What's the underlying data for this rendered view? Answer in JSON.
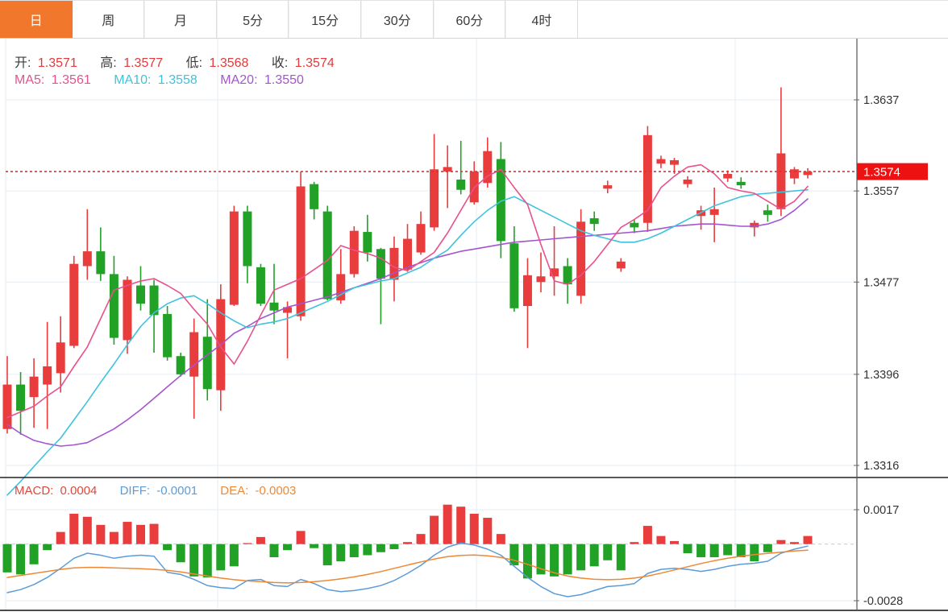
{
  "tabs": {
    "items": [
      {
        "label": "日",
        "active": true
      },
      {
        "label": "周",
        "active": false
      },
      {
        "label": "月",
        "active": false
      },
      {
        "label": "5分",
        "active": false
      },
      {
        "label": "15分",
        "active": false
      },
      {
        "label": "30分",
        "active": false
      },
      {
        "label": "60分",
        "active": false
      },
      {
        "label": "4时",
        "active": false
      }
    ]
  },
  "ohlc_row": {
    "open_label": "开:",
    "open": "1.3571",
    "high_label": "高:",
    "high": "1.3577",
    "low_label": "低:",
    "low": "1.3568",
    "close_label": "收:",
    "close": "1.3574"
  },
  "ma_row": {
    "ma5_label": "MA5:",
    "ma5": "1.3561",
    "ma10_label": "MA10:",
    "ma10": "1.3558",
    "ma20_label": "MA20:",
    "ma20": "1.3550"
  },
  "macd_row": {
    "macd_label": "MACD:",
    "macd": "0.0004",
    "diff_label": "DIFF:",
    "diff": "-0.0001",
    "dea_label": "DEA:",
    "dea": "-0.0003"
  },
  "price_axis": {
    "labels": [
      {
        "text": "1.3637",
        "price": 1.3637
      },
      {
        "text": "1.3557",
        "price": 1.3557
      },
      {
        "text": "1.3477",
        "price": 1.3477
      },
      {
        "text": "1.3396",
        "price": 1.3396
      },
      {
        "text": "1.3316",
        "price": 1.3316
      }
    ],
    "last_price_tag": "1.3574",
    "last_price": 1.3574
  },
  "macd_axis": {
    "labels": [
      {
        "text": "0.0017",
        "value": 0.0017
      },
      {
        "text": "-0.0028",
        "value": -0.0028
      }
    ]
  },
  "colors": {
    "tab_active_bg": "#f0772c",
    "up": "#e93c3c",
    "down": "#21a126",
    "ma5": "#e8508e",
    "ma10": "#3fc3dc",
    "ma20": "#a455ce",
    "diff": "#5b9cd8",
    "dea": "#ee8833",
    "value_red": "#e23b3b",
    "macd_label_red": "#dd4a3c",
    "grid": "#e7edf3",
    "axis_line": "#555555",
    "axis_text": "#333333",
    "price_tag_bg": "#ee1111",
    "price_tag_text": "#ffffff",
    "dashed_price": "#e03030",
    "zero_line": "#a8cfe8",
    "separator": "#222222"
  },
  "chart_data": {
    "type": "candlestick+macd",
    "title": "",
    "price_axis_ticks": [
      1.3637,
      1.3557,
      1.3477,
      1.3396,
      1.3316
    ],
    "macd_axis_ticks": [
      0.0017,
      -0.0028
    ],
    "current_price": 1.3574,
    "candles_ohlc": [
      [
        1.3348,
        1.3412,
        1.3344,
        1.3387
      ],
      [
        1.3387,
        1.3398,
        1.3343,
        1.3364
      ],
      [
        1.3376,
        1.341,
        1.3349,
        1.3394
      ],
      [
        1.3387,
        1.3442,
        1.3348,
        1.3403
      ],
      [
        1.3397,
        1.3447,
        1.338,
        1.3424
      ],
      [
        1.3421,
        1.35,
        1.3419,
        1.3493
      ],
      [
        1.3491,
        1.3541,
        1.3479,
        1.3504
      ],
      [
        1.3504,
        1.3525,
        1.3478,
        1.3484
      ],
      [
        1.3484,
        1.35,
        1.3422,
        1.3428
      ],
      [
        1.3426,
        1.3482,
        1.3414,
        1.3479
      ],
      [
        1.3474,
        1.3491,
        1.3452,
        1.3458
      ],
      [
        1.3474,
        1.3479,
        1.3415,
        1.3448
      ],
      [
        1.3449,
        1.3456,
        1.3408,
        1.3411
      ],
      [
        1.3412,
        1.3415,
        1.3394,
        1.3396
      ],
      [
        1.3394,
        1.3445,
        1.3357,
        1.3433
      ],
      [
        1.3429,
        1.3462,
        1.3373,
        1.3383
      ],
      [
        1.3382,
        1.3475,
        1.3364,
        1.3462
      ],
      [
        1.3457,
        1.3544,
        1.3456,
        1.3539
      ],
      [
        1.3539,
        1.3544,
        1.3476,
        1.3491
      ],
      [
        1.349,
        1.3493,
        1.3456,
        1.3458
      ],
      [
        1.3459,
        1.3493,
        1.344,
        1.3452
      ],
      [
        1.345,
        1.346,
        1.341,
        1.3455
      ],
      [
        1.3447,
        1.3574,
        1.3443,
        1.3561
      ],
      [
        1.3563,
        1.3565,
        1.3532,
        1.3541
      ],
      [
        1.3539,
        1.3544,
        1.3461,
        1.3462
      ],
      [
        1.3461,
        1.3506,
        1.3458,
        1.3484
      ],
      [
        1.3484,
        1.3526,
        1.3481,
        1.3522
      ],
      [
        1.3521,
        1.3536,
        1.3495,
        1.3503
      ],
      [
        1.3506,
        1.3507,
        1.344,
        1.348
      ],
      [
        1.3479,
        1.3517,
        1.346,
        1.3507
      ],
      [
        1.3488,
        1.3528,
        1.3486,
        1.3515
      ],
      [
        1.3503,
        1.3539,
        1.3501,
        1.3528
      ],
      [
        1.3525,
        1.3607,
        1.3522,
        1.3576
      ],
      [
        1.3574,
        1.3597,
        1.3542,
        1.3578
      ],
      [
        1.3567,
        1.3601,
        1.3554,
        1.3558
      ],
      [
        1.3547,
        1.3583,
        1.3545,
        1.3574
      ],
      [
        1.3564,
        1.3604,
        1.356,
        1.3592
      ],
      [
        1.3585,
        1.36,
        1.3498,
        1.3513
      ],
      [
        1.3511,
        1.3526,
        1.3451,
        1.3454
      ],
      [
        1.3456,
        1.3498,
        1.3419,
        1.3483
      ],
      [
        1.3477,
        1.3503,
        1.3468,
        1.3482
      ],
      [
        1.3482,
        1.3526,
        1.3465,
        1.3489
      ],
      [
        1.3491,
        1.3498,
        1.3458,
        1.3475
      ],
      [
        1.3465,
        1.3541,
        1.3458,
        1.353
      ],
      [
        1.3533,
        1.3539,
        1.3522,
        1.3528
      ],
      [
        1.3559,
        1.3566,
        1.3555,
        1.3562
      ],
      [
        1.3489,
        1.3498,
        1.3486,
        1.3495
      ],
      [
        1.3529,
        1.3532,
        1.352,
        1.3525
      ],
      [
        1.3529,
        1.3614,
        1.3521,
        1.3606
      ],
      [
        1.3581,
        1.3588,
        1.3577,
        1.3585
      ],
      [
        1.358,
        1.3586,
        1.3572,
        1.3584
      ],
      [
        1.3563,
        1.357,
        1.356,
        1.3567
      ],
      [
        1.3535,
        1.3544,
        1.3523,
        1.354
      ],
      [
        1.3536,
        1.356,
        1.3512,
        1.3541
      ],
      [
        1.3568,
        1.3575,
        1.3565,
        1.3572
      ],
      [
        1.3565,
        1.3569,
        1.3559,
        1.3562
      ],
      [
        1.3525,
        1.3531,
        1.3517,
        1.3529
      ],
      [
        1.354,
        1.3545,
        1.353,
        1.3536
      ],
      [
        1.3541,
        1.3648,
        1.3535,
        1.359
      ],
      [
        1.3568,
        1.3578,
        1.3563,
        1.3576
      ],
      [
        1.3571,
        1.3577,
        1.3568,
        1.3574
      ]
    ],
    "ma5": [
      1.3358,
      1.3363,
      1.3368,
      1.3377,
      1.3385,
      1.3403,
      1.342,
      1.3445,
      1.347,
      1.3474,
      1.3478,
      1.348,
      1.3474,
      1.3467,
      1.3453,
      1.344,
      1.342,
      1.3405,
      1.3425,
      1.3448,
      1.347,
      1.3475,
      1.348,
      1.3488,
      1.3496,
      1.3509,
      1.3505,
      1.3502,
      1.3498,
      1.349,
      1.3487,
      1.3495,
      1.3503,
      1.352,
      1.354,
      1.356,
      1.357,
      1.3576,
      1.356,
      1.3545,
      1.351,
      1.3478,
      1.3475,
      1.3483,
      1.3495,
      1.351,
      1.3525,
      1.3532,
      1.354,
      1.356,
      1.357,
      1.3578,
      1.358,
      1.3572,
      1.356,
      1.3557,
      1.3555,
      1.3548,
      1.3541,
      1.3548,
      1.3561
    ],
    "ma10": [
      1.329,
      1.3302,
      1.3315,
      1.3328,
      1.334,
      1.3356,
      1.3372,
      1.3389,
      1.3405,
      1.3422,
      1.3438,
      1.345,
      1.3458,
      1.3463,
      1.3465,
      1.3458,
      1.345,
      1.3443,
      1.3437,
      1.344,
      1.3442,
      1.3445,
      1.345,
      1.3455,
      1.346,
      1.3466,
      1.3472,
      1.3475,
      1.3478,
      1.348,
      1.3485,
      1.349,
      1.3498,
      1.3505,
      1.3518,
      1.353,
      1.354,
      1.3548,
      1.3552,
      1.3546,
      1.354,
      1.3534,
      1.3528,
      1.3522,
      1.3518,
      1.3515,
      1.3512,
      1.3512,
      1.3515,
      1.352,
      1.3526,
      1.3532,
      1.3538,
      1.3544,
      1.3548,
      1.3552,
      1.3554,
      1.3555,
      1.3556,
      1.3557,
      1.3558
    ],
    "ma20": [
      1.3352,
      1.3344,
      1.3338,
      1.3335,
      1.3333,
      1.3334,
      1.3336,
      1.3342,
      1.3348,
      1.3356,
      1.3365,
      1.3375,
      1.3385,
      1.3395,
      1.3404,
      1.3413,
      1.3422,
      1.3432,
      1.3438,
      1.3445,
      1.345,
      1.3455,
      1.3458,
      1.3461,
      1.3464,
      1.3468,
      1.3472,
      1.3476,
      1.348,
      1.3485,
      1.349,
      1.3494,
      1.3498,
      1.3501,
      1.3504,
      1.3506,
      1.3508,
      1.351,
      1.3512,
      1.3513,
      1.3514,
      1.3515,
      1.3516,
      1.3517,
      1.3518,
      1.3519,
      1.352,
      1.3521,
      1.3522,
      1.3524,
      1.3526,
      1.3527,
      1.3528,
      1.3528,
      1.3527,
      1.3526,
      1.3526,
      1.3528,
      1.3532,
      1.354,
      1.355
    ],
    "macd_hist": [
      -0.0014,
      -0.0015,
      -0.001,
      -0.0003,
      0.0006,
      0.0015,
      0.00135,
      0.00095,
      0.0006,
      0.0011,
      0.00095,
      0.001,
      -0.0003,
      -0.0009,
      -0.0016,
      -0.00165,
      -0.0013,
      -0.0011,
      5e-05,
      0.00035,
      -0.00065,
      -0.0003,
      0.00065,
      -0.0002,
      -0.00105,
      -0.00085,
      -0.00065,
      -0.00055,
      -0.0004,
      -0.00025,
      0.0001,
      0.0005,
      0.0014,
      0.00195,
      0.00185,
      0.0015,
      0.0013,
      0.0005,
      -0.00105,
      -0.0017,
      -0.0015,
      -0.0016,
      -0.0015,
      -0.0013,
      -0.0011,
      -0.0008,
      -0.0013,
      0.0001,
      0.0009,
      0.0004,
      0.00015,
      -0.00045,
      -0.00065,
      -0.00065,
      -0.00055,
      -0.00065,
      -0.00085,
      -0.0004,
      0.0002,
      0.0001,
      0.0004
    ],
    "diff": [
      -0.0024,
      -0.00225,
      -0.002,
      -0.00165,
      -0.0012,
      -0.0007,
      -0.00045,
      -0.00055,
      -0.0007,
      -0.0006,
      -0.00055,
      -0.0006,
      -0.0014,
      -0.0015,
      -0.00175,
      -0.00205,
      -0.00215,
      -0.0022,
      -0.0018,
      -0.00175,
      -0.00205,
      -0.0021,
      -0.00175,
      -0.00195,
      -0.00225,
      -0.00235,
      -0.0023,
      -0.0022,
      -0.00205,
      -0.0018,
      -0.00145,
      -0.00105,
      -0.00055,
      -0.00015,
      5e-05,
      -5e-05,
      -0.00025,
      -0.00055,
      -0.0011,
      -0.00165,
      -0.0021,
      -0.00245,
      -0.0026,
      -0.0025,
      -0.0023,
      -0.0021,
      -0.00205,
      -0.00195,
      -0.00145,
      -0.00125,
      -0.0012,
      -0.00125,
      -0.00135,
      -0.00125,
      -0.0011,
      -0.001,
      -0.00095,
      -0.00085,
      -0.00045,
      -0.00025,
      -0.0001
    ],
    "dea": [
      -0.00165,
      -0.00155,
      -0.00145,
      -0.00135,
      -0.00125,
      -0.00118,
      -0.00115,
      -0.00115,
      -0.00118,
      -0.0012,
      -0.00122,
      -0.00125,
      -0.0013,
      -0.00138,
      -0.00148,
      -0.00158,
      -0.00168,
      -0.00176,
      -0.00182,
      -0.00186,
      -0.0019,
      -0.00192,
      -0.0019,
      -0.00186,
      -0.0018,
      -0.00172,
      -0.00162,
      -0.0015,
      -0.00136,
      -0.0012,
      -0.00104,
      -0.00088,
      -0.00074,
      -0.00062,
      -0.00056,
      -0.00054,
      -0.00058,
      -0.00066,
      -0.0008,
      -0.001,
      -0.00122,
      -0.00142,
      -0.00158,
      -0.00168,
      -0.00174,
      -0.00176,
      -0.00174,
      -0.00168,
      -0.00158,
      -0.00144,
      -0.00128,
      -0.00112,
      -0.00096,
      -0.00082,
      -0.0007,
      -0.0006,
      -0.00052,
      -0.00046,
      -0.0004,
      -0.00034,
      -0.0003
    ]
  },
  "layout_hints": {
    "grid": true,
    "legend_position": "top-left-inline",
    "panels": [
      "price",
      "macd"
    ]
  }
}
